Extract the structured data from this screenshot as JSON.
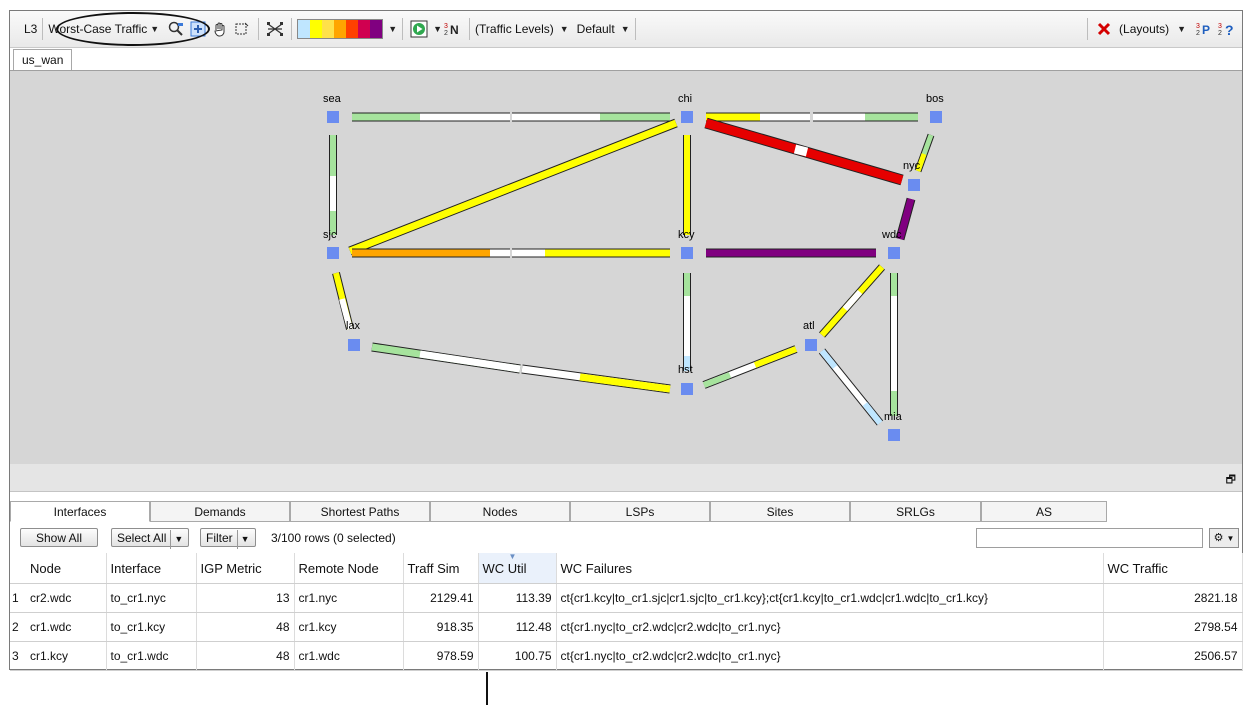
{
  "toolbar": {
    "layer": "L3",
    "traffic_view": "Worst-Case Traffic",
    "traffic_levels": "(Traffic Levels)",
    "default": "Default",
    "layouts": "(Layouts)"
  },
  "map_tab": "us_wan",
  "bottom_tabs": [
    "Interfaces",
    "Demands",
    "Shortest Paths",
    "Nodes",
    "LSPs",
    "Sites",
    "SRLGs",
    "AS"
  ],
  "table_toolbar": {
    "show_all": "Show All",
    "select_all": "Select All",
    "filter": "Filter",
    "rows_info": "3/100 rows (0 selected)",
    "search_value": ""
  },
  "table": {
    "columns": [
      "Node",
      "Interface",
      "IGP Metric",
      "Remote Node",
      "Traff Sim",
      "WC Util",
      "WC Failures",
      "WC Traffic"
    ],
    "rows": [
      {
        "num": "1",
        "node": "cr2.wdc",
        "interface": "to_cr1.nyc",
        "igp": "13",
        "remote": "cr1.nyc",
        "traff": "2129.41",
        "util": "113.39",
        "failures": "ct{cr1.kcy|to_cr1.sjc|cr1.sjc|to_cr1.kcy};ct{cr1.kcy|to_cr1.wdc|cr1.wdc|to_cr1.kcy}",
        "wct": "2821.18"
      },
      {
        "num": "2",
        "node": "cr1.wdc",
        "interface": "to_cr1.kcy",
        "igp": "48",
        "remote": "cr1.kcy",
        "traff": "918.35",
        "util": "112.48",
        "failures": "ct{cr1.nyc|to_cr2.wdc|cr2.wdc|to_cr1.nyc}",
        "wct": "2798.54"
      },
      {
        "num": "3",
        "node": "cr1.kcy",
        "interface": "to_cr1.wdc",
        "igp": "48",
        "remote": "cr1.wdc",
        "traff": "978.59",
        "util": "100.75",
        "failures": "ct{cr1.nyc|to_cr2.wdc|cr2.wdc|to_cr1.nyc}",
        "wct": "2506.57"
      }
    ]
  },
  "map": {
    "nodes": [
      "sea",
      "chi",
      "bos",
      "nyc",
      "sjc",
      "kcy",
      "wdc",
      "lax",
      "atl",
      "hst",
      "mia"
    ],
    "colors": {
      "node": "#6a8cf0",
      "green": "#a6e39d",
      "yellow": "#ffff00",
      "orange": "#ffa500",
      "red": "#e60000",
      "purple": "#800080",
      "white": "#ffffff",
      "canvas": "#d6d6d6"
    }
  },
  "legend_colors": [
    "#bfe6ff",
    "#ffff00",
    "#ffe14a",
    "#ffa500",
    "#ff4000",
    "#d00050",
    "#800080"
  ]
}
